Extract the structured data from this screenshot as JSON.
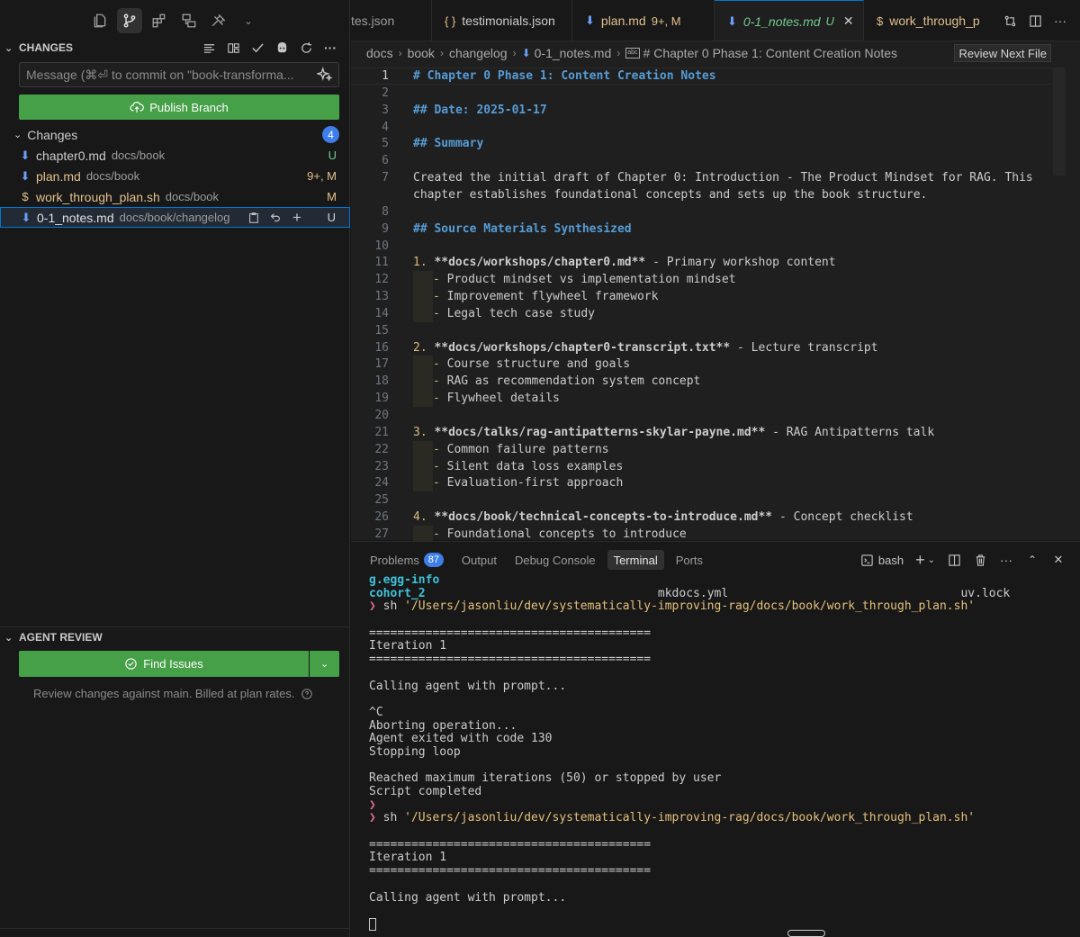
{
  "sidebar": {
    "changes_header": "CHANGES",
    "commit_placeholder": "Message (⌘⏎ to commit on \"book-transforma...",
    "publish_label": "Publish Branch",
    "changes_group": "Changes",
    "changes_count": "4",
    "files": [
      {
        "name": "chapter0.md",
        "dir": "docs/book",
        "status": "U"
      },
      {
        "name": "plan.md",
        "dir": "docs/book",
        "status": "9+, M"
      },
      {
        "name": "work_through_plan.sh",
        "dir": "docs/book",
        "status": "M"
      },
      {
        "name": "0-1_notes.md",
        "dir": "docs/book/changelog",
        "status": "U"
      }
    ],
    "agent_header": "AGENT REVIEW",
    "find_issues_label": "Find Issues",
    "review_note": "Review changes against main. Billed at plan rates."
  },
  "tabs": [
    {
      "label": "tes.json",
      "mod": ""
    },
    {
      "label": "testimonials.json",
      "mod": "",
      "icon": "{ }"
    },
    {
      "label": "plan.md",
      "mod": "9+, M"
    },
    {
      "label": "0-1_notes.md",
      "mod": "U"
    },
    {
      "label": "work_through_p",
      "mod": ""
    }
  ],
  "breadcrumb": [
    "docs",
    "book",
    "changelog",
    "0-1_notes.md",
    "# Chapter 0 Phase 1: Content Creation Notes"
  ],
  "review_next_label": "Review Next File",
  "code_lines": [
    "# Chapter 0 Phase 1: Content Creation Notes",
    "",
    "## Date: 2025-01-17",
    "",
    "## Summary",
    "",
    "Created the initial draft of Chapter 0: Introduction - The Product Mindset for RAG. This",
    "chapter establishes foundational concepts and sets up the book structure.",
    "",
    "## Source Materials Synthesized",
    "",
    "**docs/workshops/chapter0.md** - Primary workshop content",
    "Product mindset vs implementation mindset",
    "Improvement flywheel framework",
    "Legal tech case study",
    "",
    "**docs/workshops/chapter0-transcript.txt** - Lecture transcript",
    "Course structure and goals",
    "RAG as recommendation system concept",
    "Flywheel details",
    "",
    "**docs/talks/rag-antipatterns-skylar-payne.md** - RAG Antipatterns talk",
    "Common failure patterns",
    "Silent data loss examples",
    "Evaluation-first approach",
    "",
    "**docs/book/technical-concepts-to-introduce.md** - Concept checklist",
    "Foundational concepts to introduce"
  ],
  "line_numbers": [
    "1",
    "2",
    "3",
    "4",
    "5",
    "6",
    "7",
    "",
    "8",
    "9",
    "10",
    "11",
    "12",
    "13",
    "14",
    "15",
    "16",
    "17",
    "18",
    "19",
    "20",
    "21",
    "22",
    "23",
    "24",
    "25",
    "26",
    "27"
  ],
  "list_numbers": [
    "1.",
    "2.",
    "3.",
    "4."
  ],
  "list_dash": "-",
  "panel": {
    "tabs": [
      "Problems",
      "Output",
      "Debug Console",
      "Terminal",
      "Ports"
    ],
    "problems_count": "87",
    "shell": "bash"
  },
  "terminal": {
    "line1": "g.egg-info",
    "line2": "cohort_2                                 mkdocs.yml                                 uv.lock",
    "prompt": "❯",
    "cmd": "sh",
    "script_path": "'/Users/jasonliu/dev/systematically-improving-rag/docs/book/work_through_plan.sh'",
    "rule": "========================================",
    "iteration": "Iteration 1",
    "calling": "Calling agent with prompt...",
    "ctrl_c": "^C",
    "aborting": "Aborting operation...",
    "exit": "Agent exited with code 130",
    "stopping": "Stopping loop",
    "reached": "Reached maximum iterations (50) or stopped by user",
    "completed": "Script completed"
  }
}
